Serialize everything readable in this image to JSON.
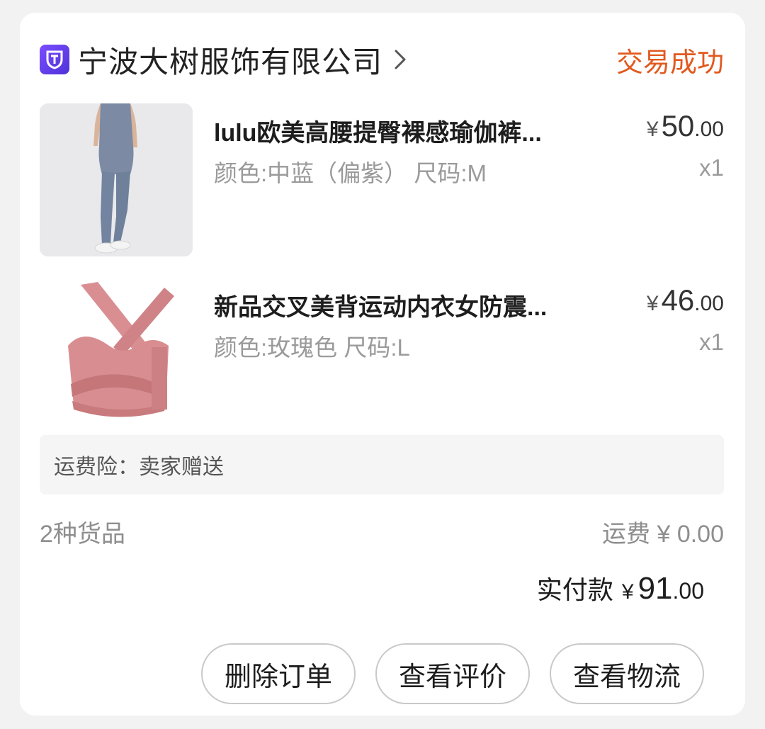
{
  "order": {
    "store_name": "宁波大树服饰有限公司",
    "status": "交易成功",
    "status_color": "#e2591f",
    "store_icon": "store-badge-icon",
    "items": [
      {
        "title": "lulu欧美高腰提臀裸感瑜伽裤...",
        "spec": "颜色:中蓝（偏紫） 尺码:M",
        "price_symbol": "¥",
        "price_int": "50",
        "price_dec": ".00",
        "quantity": "x1",
        "image": "blue-leggings-product-image"
      },
      {
        "title": "新品交叉美背运动内衣女防震...",
        "spec": "颜色:玫瑰色 尺码:L",
        "price_symbol": "¥",
        "price_int": "46",
        "price_dec": ".00",
        "quantity": "x1",
        "image": "pink-sports-bra-product-image"
      }
    ],
    "insurance": "运费险：卖家赠送",
    "goods_count": "2种货品",
    "shipping": "运费 ¥ 0.00",
    "paid": {
      "label": "实付款",
      "symbol": "¥",
      "int": "91",
      "dec": ".00"
    },
    "actions": {
      "delete": "删除订单",
      "review": "查看评价",
      "logistics": "查看物流"
    }
  }
}
